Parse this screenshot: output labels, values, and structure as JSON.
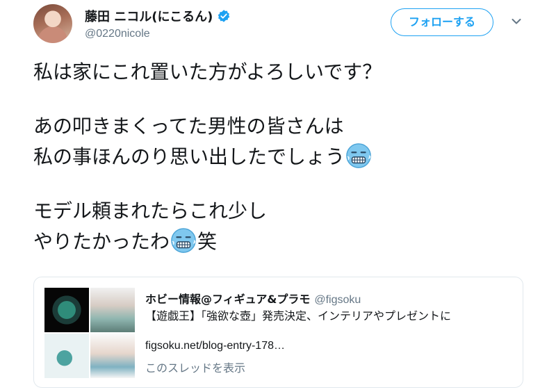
{
  "header": {
    "display_name": "藤田 ニコル(にこるん)",
    "handle": "@0220nicole",
    "follow_label": "フォローする"
  },
  "tweet": {
    "line1": "私は家にこれ置いた方がよろしいです？",
    "line2": "あの叩きまくってた男性の皆さんは",
    "line3": "私の事ほんのり思い出したでしょう",
    "line4": "モデル頼まれたらこれ少し",
    "line5a": "やりたかったわ",
    "line5b": "笑"
  },
  "quoted": {
    "author": "ホビー情報@フィギュア&プラモ",
    "handle": "@figsoku",
    "description": "【遊戯王】「強欲な壺」発売決定、インテリアやプレゼントに",
    "link": "figsoku.net/blog-entry-178…",
    "thread_label": "このスレッドを表示"
  },
  "icons": {
    "verified": "verified-badge-icon",
    "chevron": "chevron-down-icon",
    "emoji": "cold-face-emoji"
  },
  "colors": {
    "accent": "#1da1f2",
    "muted": "#657786",
    "text": "#14171a"
  }
}
